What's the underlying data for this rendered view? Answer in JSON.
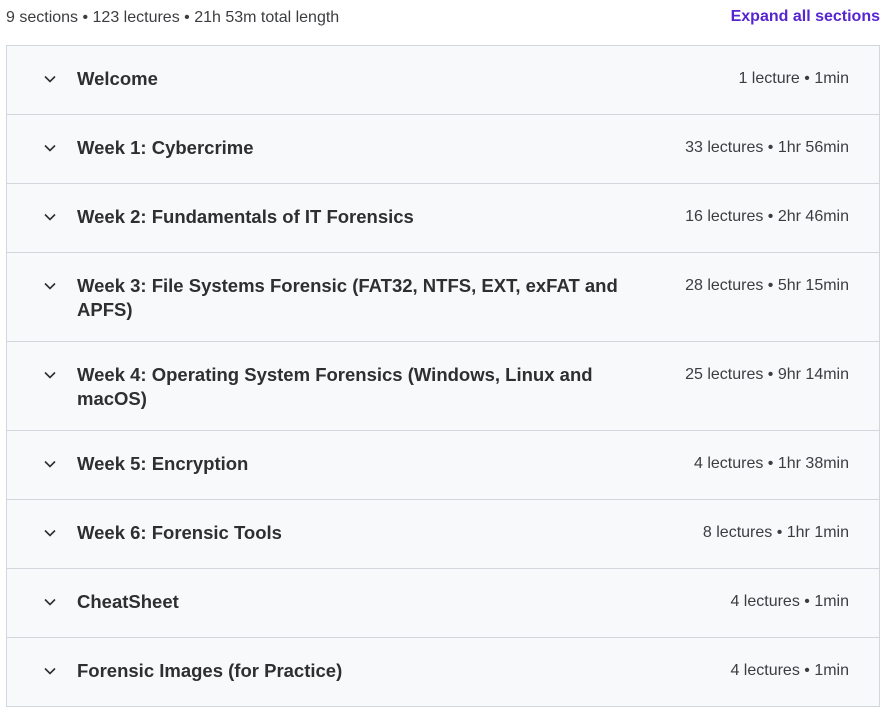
{
  "summary": "9 sections • 123 lectures • 21h 53m total length",
  "expand_all_label": "Expand all sections",
  "colors": {
    "accent": "#5624d0",
    "section_bg": "#f7f9fa",
    "border": "#d1d7dc",
    "text": "#2d2f31"
  },
  "icons": {
    "section_toggle": "chevron-down-icon"
  },
  "sections": [
    {
      "title": "Welcome",
      "meta": "1 lecture • 1min"
    },
    {
      "title": "Week 1: Cybercrime",
      "meta": "33 lectures • 1hr 56min"
    },
    {
      "title": "Week 2: Fundamentals of IT Forensics",
      "meta": "16 lectures • 2hr 46min"
    },
    {
      "title": "Week 3: File Systems Forensic (FAT32, NTFS, EXT, exFAT and APFS)",
      "meta": "28 lectures • 5hr 15min"
    },
    {
      "title": "Week 4: Operating System Forensics (Windows, Linux and macOS)",
      "meta": "25 lectures • 9hr 14min"
    },
    {
      "title": "Week 5: Encryption",
      "meta": "4 lectures • 1hr 38min"
    },
    {
      "title": "Week 6: Forensic Tools",
      "meta": "8 lectures • 1hr 1min"
    },
    {
      "title": "CheatSheet",
      "meta": "4 lectures • 1min"
    },
    {
      "title": "Forensic Images (for Practice)",
      "meta": "4 lectures • 1min"
    }
  ]
}
